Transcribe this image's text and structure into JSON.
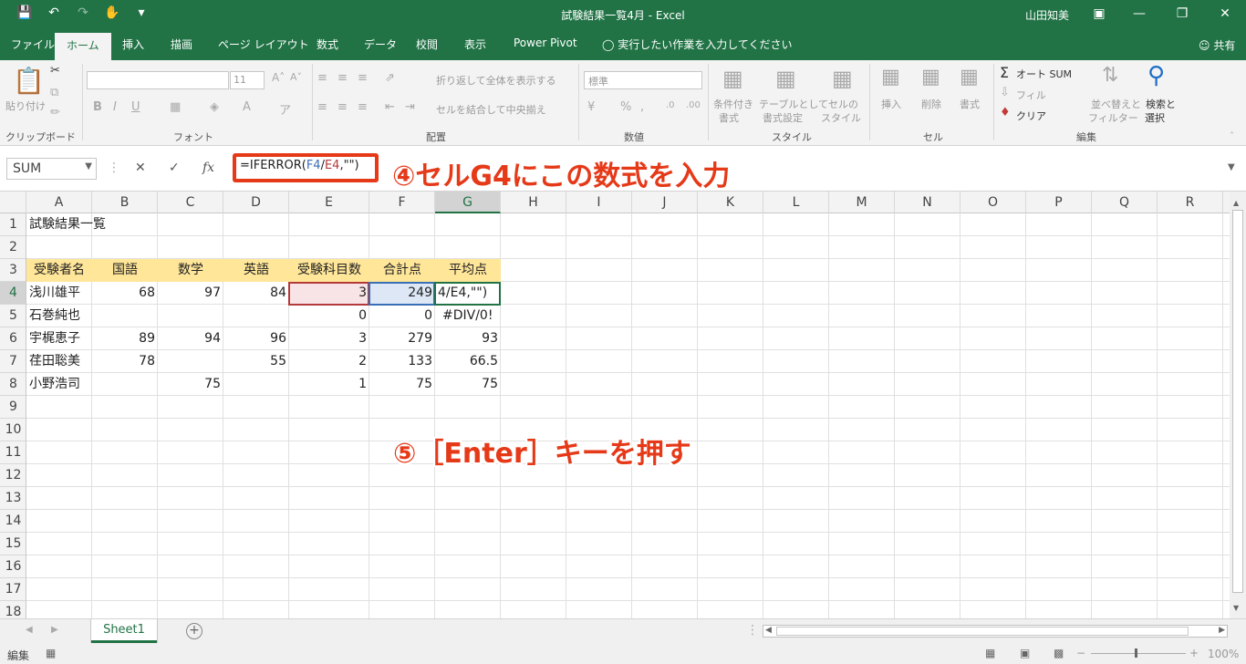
{
  "window": {
    "title": "試験結果一覧4月  -  Excel",
    "user": "山田知美",
    "share": "共有"
  },
  "ribbon_tabs": [
    "ファイル",
    "ホーム",
    "挿入",
    "描画",
    "ページ レイアウト",
    "数式",
    "データ",
    "校閲",
    "表示",
    "Power Pivot",
    "実行したい作業を入力してください"
  ],
  "ribbon": {
    "clipboard": {
      "paste": "貼り付け",
      "label": "クリップボード"
    },
    "font": {
      "size": "11",
      "label": "フォント"
    },
    "alignment": {
      "wrap": "折り返して全体を表示する",
      "merge": "セルを結合して中央揃え",
      "label": "配置"
    },
    "number": {
      "format": "標準",
      "label": "数値"
    },
    "styles": {
      "cond_line1": "条件付き",
      "cond_line2": "書式",
      "table_line1": "テーブルとして",
      "table_line2": "書式設定",
      "cell_line1": "セルの",
      "cell_line2": "スタイル",
      "label": "スタイル"
    },
    "cells": {
      "insert": "挿入",
      "delete": "削除",
      "format": "書式",
      "label": "セル"
    },
    "editing": {
      "autosum": "オート SUM",
      "fill": "フィル",
      "clear": "クリア",
      "sort_line1": "並べ替えと",
      "sort_line2": "フィルター",
      "find_line1": "検索と",
      "find_line2": "選択",
      "label": "編集"
    }
  },
  "formula_bar": {
    "name_box": "SUM",
    "formula_prefix": "=IFERROR(",
    "formula_ref1": "F4",
    "formula_slash": "/",
    "formula_ref2": "E4",
    "formula_suffix": ",\"\")"
  },
  "annotations": {
    "step4": "④セルG4にこの数式を入力",
    "step5": "⑤［Enter］キーを押す"
  },
  "columns": [
    "A",
    "B",
    "C",
    "D",
    "E",
    "F",
    "G",
    "H",
    "I",
    "J",
    "K",
    "L",
    "M",
    "N",
    "O",
    "P",
    "Q",
    "R"
  ],
  "rows": [
    "1",
    "2",
    "3",
    "4",
    "5",
    "6",
    "7",
    "8",
    "9",
    "10",
    "11",
    "12",
    "13",
    "14",
    "15",
    "16",
    "17",
    "18"
  ],
  "sheet": {
    "title": "試験結果一覧",
    "headers": [
      "受験者名",
      "国語",
      "数学",
      "英語",
      "受験科目数",
      "合計点",
      "平均点"
    ],
    "data": [
      [
        "浅川雄平",
        "68",
        "97",
        "84",
        "3",
        "249",
        "4/E4,\"\")"
      ],
      [
        "石巻純也",
        "",
        "",
        "",
        "0",
        "0",
        "#DIV/0!"
      ],
      [
        "宇梶恵子",
        "89",
        "94",
        "96",
        "3",
        "279",
        "93"
      ],
      [
        "荏田聡美",
        "78",
        "",
        "55",
        "2",
        "133",
        "66.5"
      ],
      [
        "小野浩司",
        "",
        "75",
        "",
        "1",
        "75",
        "75"
      ]
    ]
  },
  "sheet_tabs": [
    "Sheet1"
  ],
  "status": {
    "mode": "編集",
    "zoom": "100%"
  }
}
